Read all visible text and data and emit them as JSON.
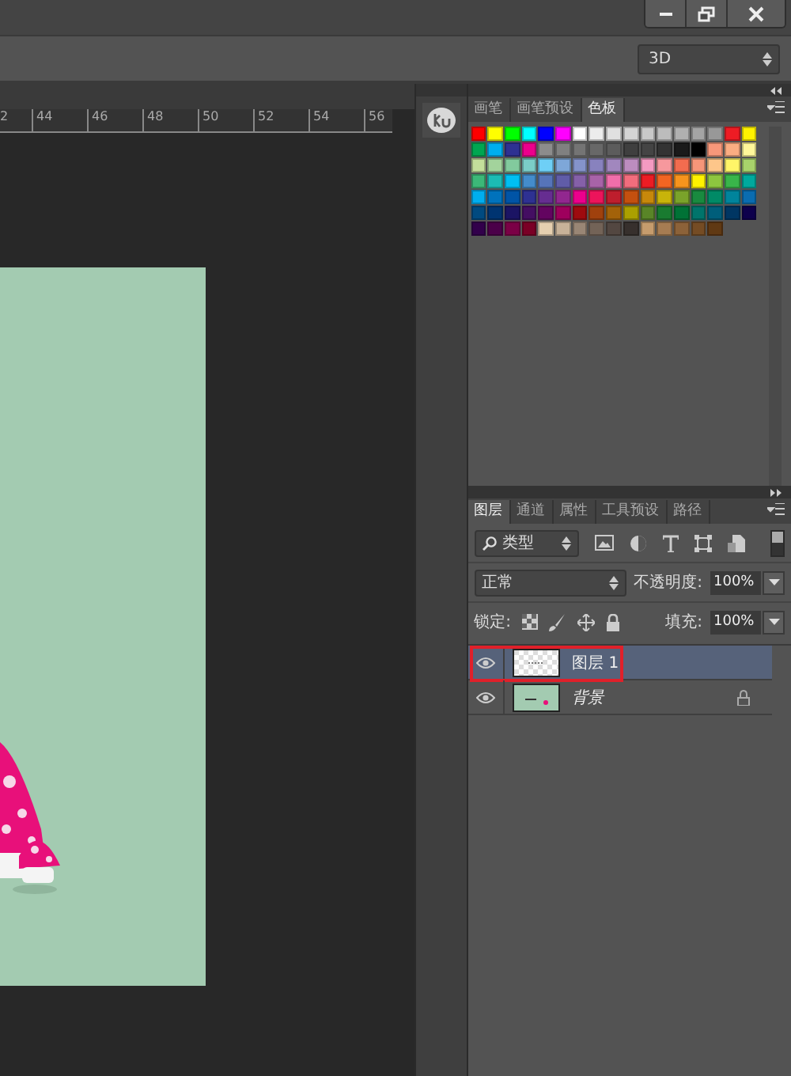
{
  "options_bar": {
    "workspace": "3D"
  },
  "ruler": {
    "labels": [
      "2",
      "44",
      "46",
      "48",
      "50",
      "52",
      "54",
      "56"
    ]
  },
  "swatches_panel": {
    "tabs": [
      {
        "label": "画笔",
        "selected": false
      },
      {
        "label": "画笔预设",
        "selected": false
      },
      {
        "label": "色板",
        "selected": true
      }
    ],
    "rows": [
      [
        {
          "color": "#ff0000"
        },
        {
          "color": "#ffff00"
        },
        {
          "color": "#00ff00"
        },
        {
          "color": "#00ffff"
        },
        {
          "color": "#0000ff"
        },
        {
          "color": "#ff00ff"
        },
        {
          "color": "#ffffff"
        },
        {
          "color": "#ececec"
        },
        {
          "color": "#e0e0e0"
        },
        {
          "color": "#d4d4d4"
        },
        {
          "color": "#c8c8c8"
        },
        {
          "color": "#bcbcbc"
        },
        {
          "color": "#b0b0b0"
        },
        {
          "color": "#a4a4a4"
        },
        {
          "color": "#989898"
        },
        {
          "color": "#ee1c24"
        },
        {
          "color": "#fff200"
        }
      ],
      [
        {
          "color": "#00a651"
        },
        {
          "color": "#00aeef"
        },
        {
          "color": "#2e3192"
        },
        {
          "color": "#ec008c"
        },
        {
          "color": "#8c8c8c"
        },
        {
          "color": "#808080"
        },
        {
          "color": "#747474"
        },
        {
          "color": "#686868"
        },
        {
          "color": "#5c5c5c"
        },
        {
          "color": "#3f3f3f"
        },
        {
          "color": "#444444"
        },
        {
          "color": "#333333"
        },
        {
          "color": "#1a1a1a"
        },
        {
          "color": "#000000"
        },
        {
          "color": "#f7977a"
        },
        {
          "color": "#fbad82"
        },
        {
          "color": "#fff79a"
        }
      ],
      [
        {
          "color": "#c4df9b"
        },
        {
          "color": "#a3d39c"
        },
        {
          "color": "#82ca9d"
        },
        {
          "color": "#7bcdc8"
        },
        {
          "color": "#6ecff6"
        },
        {
          "color": "#7ea7d8"
        },
        {
          "color": "#8493ca"
        },
        {
          "color": "#8882be"
        },
        {
          "color": "#a187be"
        },
        {
          "color": "#bc8dbf"
        },
        {
          "color": "#f49ac2"
        },
        {
          "color": "#f6989d"
        },
        {
          "color": "#f26c4f"
        },
        {
          "color": "#f69679"
        },
        {
          "color": "#fdc68a"
        },
        {
          "color": "#fff568"
        },
        {
          "color": "#a8d26b"
        }
      ],
      [
        {
          "color": "#3cb878"
        },
        {
          "color": "#1cbbb4"
        },
        {
          "color": "#00bff3"
        },
        {
          "color": "#448ccb"
        },
        {
          "color": "#5674b9"
        },
        {
          "color": "#605ca8"
        },
        {
          "color": "#8560a8"
        },
        {
          "color": "#a863a8"
        },
        {
          "color": "#f06eaa"
        },
        {
          "color": "#f26d7d"
        },
        {
          "color": "#ed1c24"
        },
        {
          "color": "#f26522"
        },
        {
          "color": "#f7941d"
        },
        {
          "color": "#fff200"
        },
        {
          "color": "#8dc63f"
        },
        {
          "color": "#39b54a"
        },
        {
          "color": "#00a99d"
        }
      ],
      [
        {
          "color": "#00aeef"
        },
        {
          "color": "#0072bc"
        },
        {
          "color": "#0054a6"
        },
        {
          "color": "#2e3192"
        },
        {
          "color": "#662d91"
        },
        {
          "color": "#92278f"
        },
        {
          "color": "#ec008c"
        },
        {
          "color": "#ed145b"
        },
        {
          "color": "#be1e2d"
        },
        {
          "color": "#c4500f"
        },
        {
          "color": "#c7880b"
        },
        {
          "color": "#c8b40a"
        },
        {
          "color": "#7aa32a"
        },
        {
          "color": "#198a3f"
        },
        {
          "color": "#008a66"
        },
        {
          "color": "#00849c"
        },
        {
          "color": "#0a6cb0"
        }
      ],
      [
        {
          "color": "#004a80"
        },
        {
          "color": "#003471"
        },
        {
          "color": "#1b1464"
        },
        {
          "color": "#440e62"
        },
        {
          "color": "#630460"
        },
        {
          "color": "#9e005d"
        },
        {
          "color": "#9e0b0f"
        },
        {
          "color": "#a0410d"
        },
        {
          "color": "#a36209"
        },
        {
          "color": "#aba000"
        },
        {
          "color": "#598527"
        },
        {
          "color": "#197b30"
        },
        {
          "color": "#007236"
        },
        {
          "color": "#00746b"
        },
        {
          "color": "#005e7a"
        },
        {
          "color": "#003663"
        },
        {
          "color": "#0d004c"
        }
      ],
      [
        {
          "color": "#32004b"
        },
        {
          "color": "#4b0049"
        },
        {
          "color": "#7b0046"
        },
        {
          "color": "#7a0026"
        },
        {
          "color": "#e6d0b0"
        },
        {
          "color": "#c7b299"
        },
        {
          "color": "#998675"
        },
        {
          "color": "#736357"
        },
        {
          "color": "#534741"
        },
        {
          "color": "#37302d"
        },
        {
          "color": "#c69c6d"
        },
        {
          "color": "#a67c52"
        },
        {
          "color": "#8c6239"
        },
        {
          "color": "#754c24"
        },
        {
          "color": "#603913"
        }
      ]
    ]
  },
  "layers_panel": {
    "tabs": [
      {
        "label": "图层",
        "selected": true
      },
      {
        "label": "通道",
        "selected": false
      },
      {
        "label": "属性",
        "selected": false
      },
      {
        "label": "工具预设",
        "selected": false
      },
      {
        "label": "路径",
        "selected": false
      }
    ],
    "filter": "类型",
    "blend_mode": "正常",
    "opacity_label": "不透明度:",
    "opacity": "100%",
    "lock_label": "锁定:",
    "fill_label": "填充:",
    "fill": "100%",
    "layers": [
      {
        "name": "图层 1",
        "kind": "transparent",
        "selected": true,
        "visible": true,
        "locked": false,
        "annotated": true
      },
      {
        "name": "背景",
        "kind": "background",
        "selected": false,
        "visible": true,
        "locked": true,
        "annotated": false
      }
    ]
  }
}
